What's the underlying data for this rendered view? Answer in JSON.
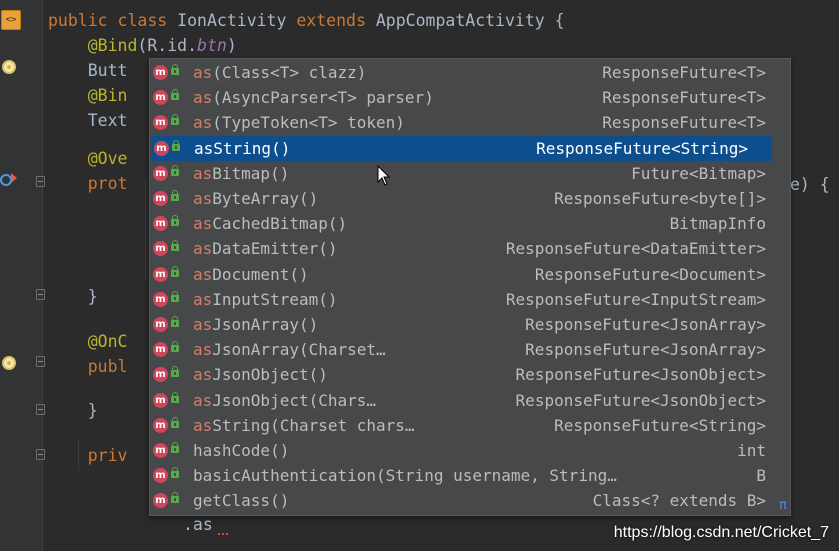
{
  "editor": {
    "lines": [
      {
        "id": "l1",
        "parts": [
          {
            "t": "public ",
            "c": "kw"
          },
          {
            "t": "class ",
            "c": "kw"
          },
          {
            "t": "IonActivity ",
            "c": "plain"
          },
          {
            "t": "extends ",
            "c": "kw"
          },
          {
            "t": "AppCompatActivity {",
            "c": "plain"
          }
        ]
      },
      {
        "id": "l2",
        "parts": [
          {
            "t": "    @Bind",
            "c": "ann"
          },
          {
            "t": "(R.id.",
            "c": "plain"
          },
          {
            "t": "btn",
            "c": "ital"
          },
          {
            "t": ")",
            "c": "plain"
          }
        ]
      },
      {
        "id": "l3",
        "parts": [
          {
            "t": "    Butt",
            "c": "plain"
          }
        ]
      },
      {
        "id": "l4",
        "parts": [
          {
            "t": "    @Bin",
            "c": "ann"
          }
        ]
      },
      {
        "id": "l5",
        "parts": [
          {
            "t": "    Text",
            "c": "plain"
          }
        ]
      },
      {
        "id": "l6",
        "parts": [
          {
            "t": "    @Ove",
            "c": "ann"
          }
        ]
      },
      {
        "id": "l7",
        "parts": [
          {
            "t": "    prot",
            "c": "kw"
          }
        ]
      },
      {
        "id": "l8",
        "parts": [
          {
            "t": "    }",
            "c": "plain"
          }
        ]
      },
      {
        "id": "l9",
        "parts": [
          {
            "t": "    @OnC",
            "c": "ann"
          }
        ]
      },
      {
        "id": "l10",
        "parts": [
          {
            "t": "    publ",
            "c": "kw"
          }
        ]
      },
      {
        "id": "l11",
        "parts": [
          {
            "t": "    }",
            "c": "plain"
          }
        ]
      },
      {
        "id": "l12",
        "parts": [
          {
            "t": "    priv",
            "c": "kw"
          }
        ]
      }
    ],
    "right_fragment": "e) {",
    "typed_text": ".as"
  },
  "completion": {
    "items": [
      {
        "icon": "m",
        "hl": "as",
        "rest": "(Class<T> clazz)",
        "ret": "ResponseFuture<T>"
      },
      {
        "icon": "m",
        "hl": "as",
        "rest": "(AsyncParser<T> parser)",
        "ret": "ResponseFuture<T>"
      },
      {
        "icon": "m",
        "hl": "as",
        "rest": "(TypeToken<T> token)",
        "ret": "ResponseFuture<T>"
      },
      {
        "icon": "m",
        "hl": "as",
        "rest": "String()",
        "ret": "ResponseFuture<String>",
        "selected": true
      },
      {
        "icon": "m",
        "hl": "as",
        "rest": "Bitmap()",
        "ret": "Future<Bitmap>"
      },
      {
        "icon": "m",
        "hl": "as",
        "rest": "ByteArray()",
        "ret": "ResponseFuture<byte[]>"
      },
      {
        "icon": "m",
        "hl": "as",
        "rest": "CachedBitmap()",
        "ret": "BitmapInfo"
      },
      {
        "icon": "m",
        "hl": "as",
        "rest": "DataEmitter()",
        "ret": "ResponseFuture<DataEmitter>"
      },
      {
        "icon": "m",
        "hl": "as",
        "rest": "Document()",
        "ret": "ResponseFuture<Document>"
      },
      {
        "icon": "m",
        "hl": "as",
        "rest": "InputStream()",
        "ret": "ResponseFuture<InputStream>"
      },
      {
        "icon": "m",
        "hl": "as",
        "rest": "JsonArray()",
        "ret": "ResponseFuture<JsonArray>"
      },
      {
        "icon": "m",
        "hl": "as",
        "rest": "JsonArray(Charset…",
        "ret": "ResponseFuture<JsonArray>"
      },
      {
        "icon": "m",
        "hl": "as",
        "rest": "JsonObject()",
        "ret": "ResponseFuture<JsonObject>"
      },
      {
        "icon": "m",
        "hl": "as",
        "rest": "JsonObject(Chars…",
        "ret": "ResponseFuture<JsonObject>"
      },
      {
        "icon": "m",
        "hl": "as",
        "rest": "String(Charset chars…",
        "ret": "ResponseFuture<String>"
      },
      {
        "icon": "m",
        "hl": "",
        "rest": "hashCode()",
        "ret": "int"
      },
      {
        "icon": "m",
        "hl": "",
        "rest": "basicAuthentication(String username, String…",
        "ret": "B"
      },
      {
        "icon": "m",
        "hl": "",
        "rest": "getClass()",
        "ret": "Class<? extends B>"
      }
    ],
    "corner_glyph": "π"
  },
  "watermark": "https://blog.csdn.net/Cricket_7",
  "colors": {
    "background": "#2b2b2b",
    "keyword": "#cc7832",
    "annotation": "#bbb529",
    "selection": "#0d4f8e",
    "popup": "#46484a"
  }
}
